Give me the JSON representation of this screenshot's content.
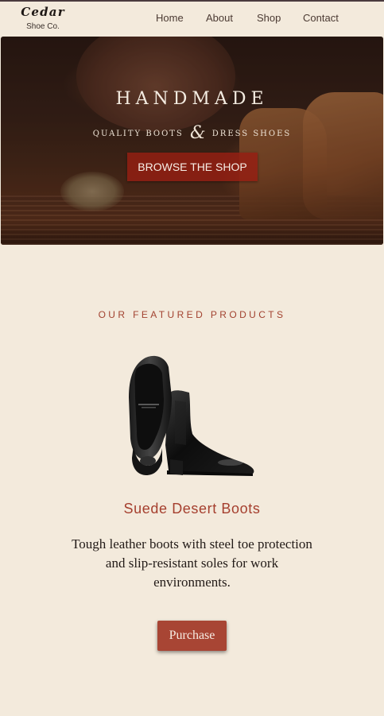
{
  "header": {
    "logo_name": "Cedar",
    "logo_sub": "Shoe Co.",
    "nav": [
      "Home",
      "About",
      "Shop",
      "Contact"
    ]
  },
  "hero": {
    "title": "HANDMADE",
    "subtitle_left": "QUALITY BOOTS",
    "subtitle_amp": "&",
    "subtitle_right": "DRESS SHOES",
    "button_label": "BROWSE THE SHOP",
    "button_color": "#961e12"
  },
  "featured": {
    "heading": "OUR FEATURED PRODUCTS",
    "product": {
      "title": "Suede Desert Boots",
      "description": "Tough leather boots with steel toe protection and slip-resistant soles for work environments.",
      "button_label": "Purchase",
      "image_icon": "black-chelsea-boot"
    }
  },
  "colors": {
    "background": "#f3eadc",
    "accent": "#a84534",
    "heading_accent": "#a24230"
  }
}
